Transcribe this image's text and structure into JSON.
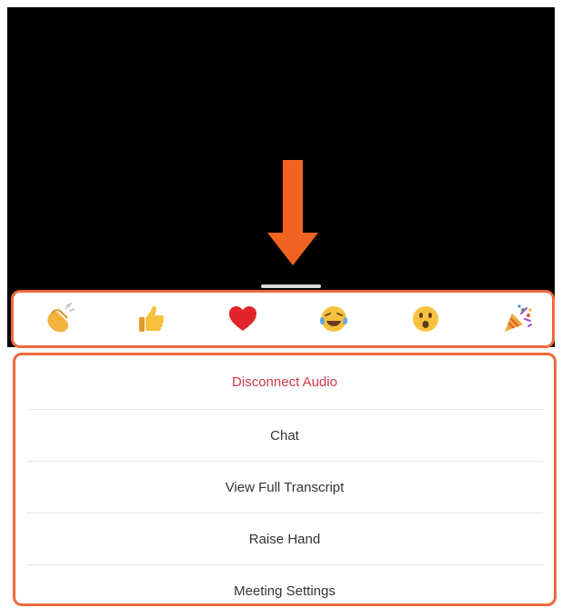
{
  "colors": {
    "highlight": "#ee6a3c",
    "danger_text": "#d2384a",
    "video_background": "#000000"
  },
  "annotation": {
    "arrow_icon": "down-arrow-icon"
  },
  "reactions": [
    {
      "name": "clapping-hands",
      "emoji": "👏"
    },
    {
      "name": "thumbs-up",
      "emoji": "👍"
    },
    {
      "name": "heart",
      "emoji": "❤️"
    },
    {
      "name": "tears-of-joy",
      "emoji": "😂"
    },
    {
      "name": "open-mouth",
      "emoji": "😮"
    },
    {
      "name": "party-popper",
      "emoji": "🎉"
    }
  ],
  "menu": {
    "disconnect_audio": "Disconnect Audio",
    "chat": "Chat",
    "view_full_transcript": "View Full Transcript",
    "raise_hand": "Raise Hand",
    "meeting_settings": "Meeting Settings"
  }
}
